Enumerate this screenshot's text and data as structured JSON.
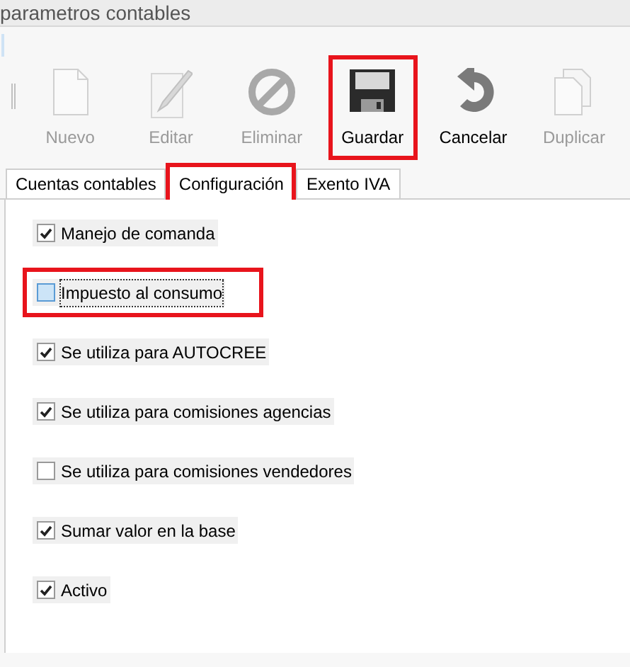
{
  "window": {
    "title": "parametros contables"
  },
  "toolbar": [
    {
      "kind": "new",
      "label": "Nuevo",
      "disabled": true,
      "highlighted": false
    },
    {
      "kind": "edit",
      "label": "Editar",
      "disabled": true,
      "highlighted": false
    },
    {
      "kind": "delete",
      "label": "Eliminar",
      "disabled": true,
      "highlighted": false
    },
    {
      "kind": "save",
      "label": "Guardar",
      "disabled": false,
      "highlighted": true
    },
    {
      "kind": "cancel",
      "label": "Cancelar",
      "disabled": false,
      "highlighted": false
    },
    {
      "kind": "duplicate",
      "label": "Duplicar",
      "disabled": true,
      "highlighted": false
    }
  ],
  "tabs": [
    {
      "label": "Cuentas contables",
      "selected": false,
      "highlighted": false
    },
    {
      "label": "Configuración",
      "selected": true,
      "highlighted": true
    },
    {
      "label": "Exento IVA",
      "selected": false,
      "highlighted": false
    }
  ],
  "options": [
    {
      "label": "Manejo de comanda",
      "checked": true,
      "focused": false,
      "highlighted": false
    },
    {
      "label": "Impuesto al consumo",
      "checked": false,
      "focused": true,
      "highlighted": true
    },
    {
      "label": "Se utiliza para AUTOCREE",
      "checked": true,
      "focused": false,
      "highlighted": false
    },
    {
      "label": "Se utiliza para comisiones agencias",
      "checked": true,
      "focused": false,
      "highlighted": false
    },
    {
      "label": "Se utiliza para comisiones vendedores",
      "checked": false,
      "focused": false,
      "highlighted": false
    },
    {
      "label": "Sumar valor en la base",
      "checked": true,
      "focused": false,
      "highlighted": false
    },
    {
      "label": "Activo",
      "checked": true,
      "focused": false,
      "highlighted": false
    }
  ]
}
